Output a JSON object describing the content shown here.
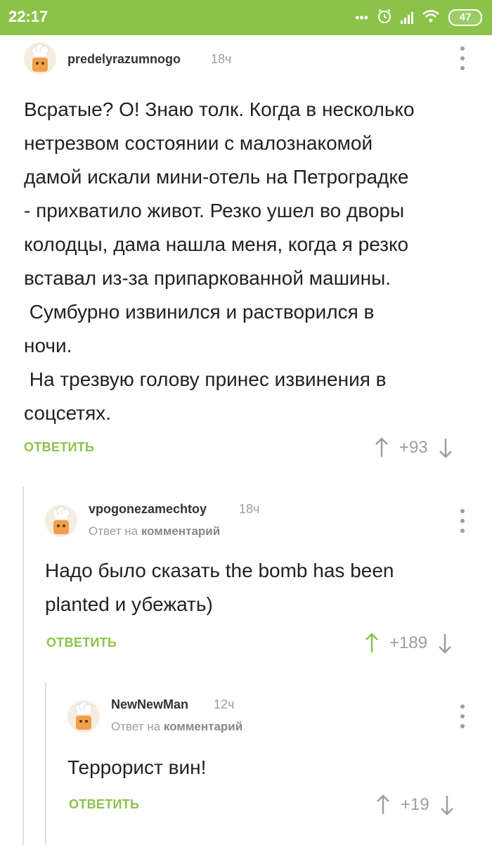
{
  "status_bar": {
    "time": "22:17",
    "notification_dots": "•••",
    "battery": "47",
    "color": "#8bc34a"
  },
  "comments": [
    {
      "author": "predelyrazumnogo",
      "time": "18ч",
      "reply_to": null,
      "body": "Всратые? О! Знаю толк. Когда в несколько\nнетрезвом состоянии с малознакомой\nдамой искали мини-отель на Петроградке\n- прихватило живот. Резко ушел во дворы\nколодцы, дама нашла меня, когда я резко\nвставал из-за припаркованной машины.\n Сумбурно извинился и растворился в\nночи.\n На трезвую голову принес извинения в\nсоцсетях.",
      "reply_label": "ОТВЕТИТЬ",
      "score": "+93",
      "upvoted": false
    },
    {
      "author": "vpogonezamechtoy",
      "time": "18ч",
      "reply_to_prefix": "Ответ на",
      "reply_to_link": "комментарий",
      "body": "Надо было сказать the bomb has been\nplanted и убежать)",
      "reply_label": "ОТВЕТИТЬ",
      "score": "+189",
      "upvoted": true
    },
    {
      "author": "NewNewMan",
      "time": "12ч",
      "reply_to_prefix": "Ответ на",
      "reply_to_link": "комментарий",
      "body": "Террорист вин!",
      "reply_label": "ОТВЕТИТЬ",
      "score": "+19",
      "upvoted": false
    }
  ],
  "colors": {
    "accent_green": "#8bc34a",
    "muted_gray": "#9e9e9e",
    "thread_line": "#e0e0e0"
  }
}
